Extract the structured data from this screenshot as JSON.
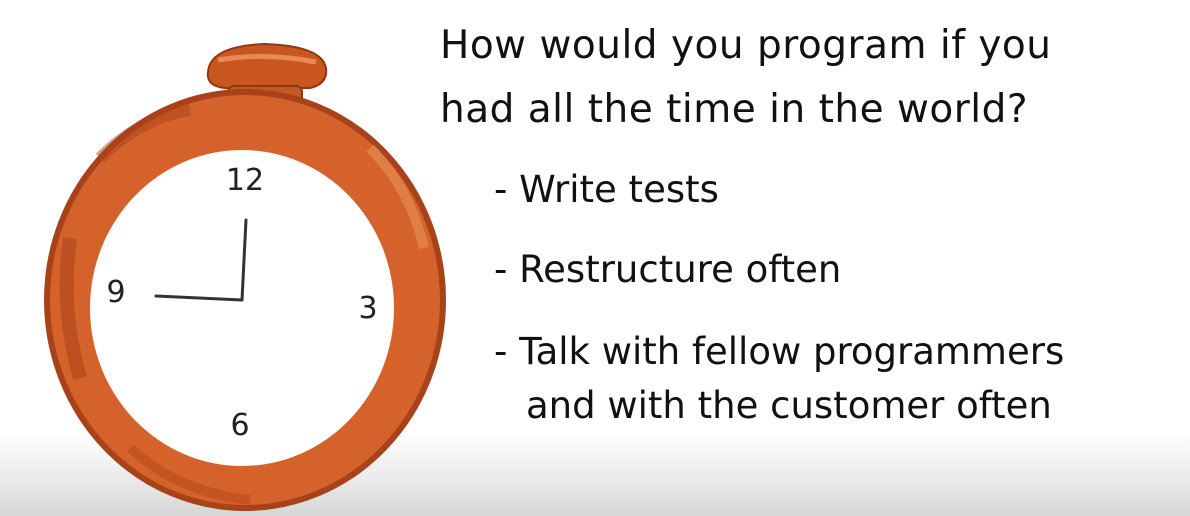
{
  "heading": {
    "line1": "How would you program if you",
    "line2": "had all the time in the world?"
  },
  "bullets": [
    {
      "text": "- Write tests"
    },
    {
      "text": "- Restructure often"
    },
    {
      "text": "- Talk with fellow programmers",
      "continuation": "and with the customer often"
    }
  ],
  "clock": {
    "numerals": {
      "twelve": "12",
      "three": "3",
      "six": "6",
      "nine": "9"
    },
    "icon": "stopwatch-icon",
    "colors": {
      "ring": "#d4622a",
      "ring_dark": "#a8421a",
      "face": "#ffffff",
      "hands": "#333333"
    }
  }
}
